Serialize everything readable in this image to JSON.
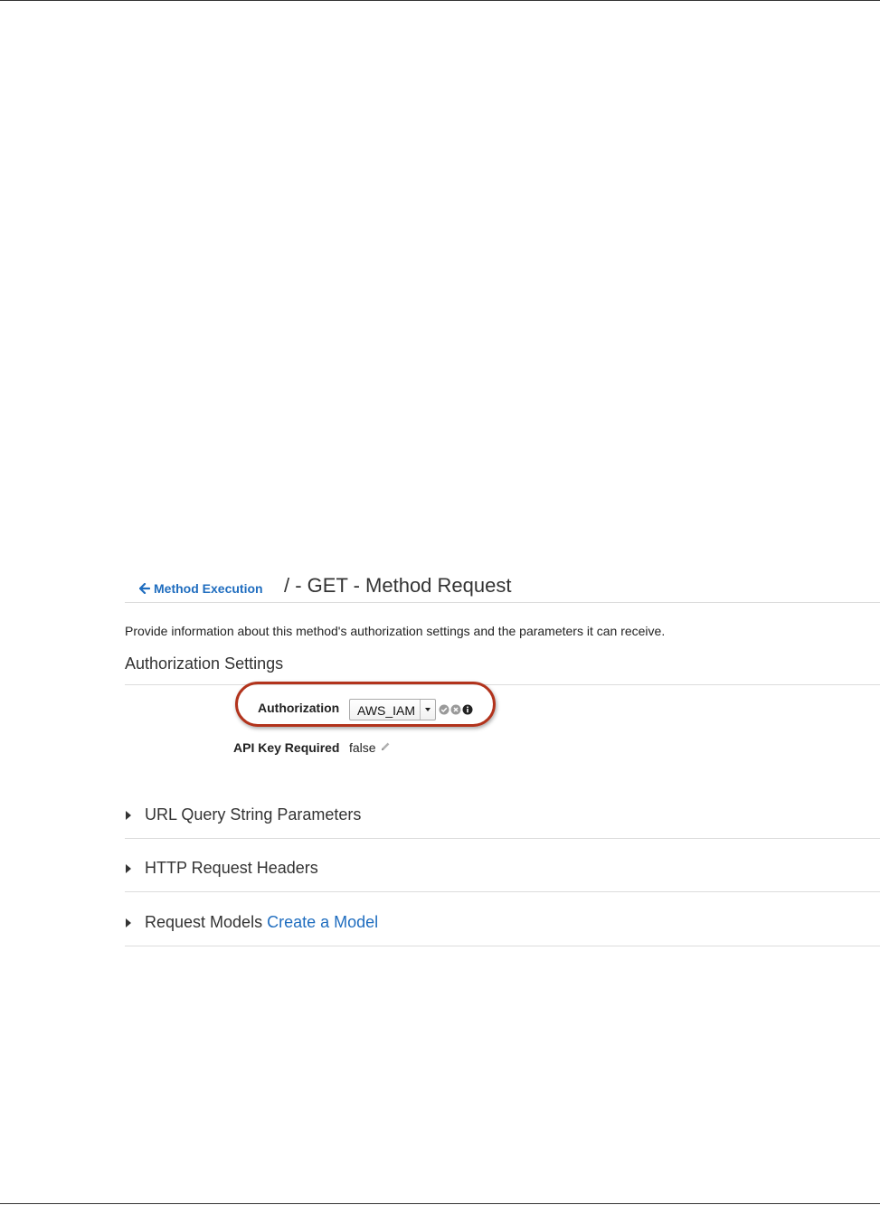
{
  "header": {
    "back_link_label": "Method Execution",
    "title": "/ - GET - Method Request"
  },
  "description": "Provide information about this method's authorization settings and the parameters it can receive.",
  "authorization_settings": {
    "section_title": "Authorization Settings",
    "authorization_label": "Authorization",
    "authorization_value": "AWS_IAM",
    "api_key_label": "API Key Required",
    "api_key_value": "false"
  },
  "sections": {
    "url_query": "URL Query String Parameters",
    "http_headers": "HTTP Request Headers",
    "request_models": "Request Models",
    "create_model_link": "Create a Model"
  },
  "icons": {
    "back": "arrow-left-icon",
    "dropdown": "caret-down-icon",
    "confirm": "check-circle-icon",
    "cancel": "x-circle-icon",
    "info": "info-circle-icon",
    "edit": "pencil-icon",
    "expand": "caret-right-icon"
  },
  "colors": {
    "link": "#1f6dbf",
    "highlight": "#b2331c",
    "rule": "#dcdcdc"
  }
}
